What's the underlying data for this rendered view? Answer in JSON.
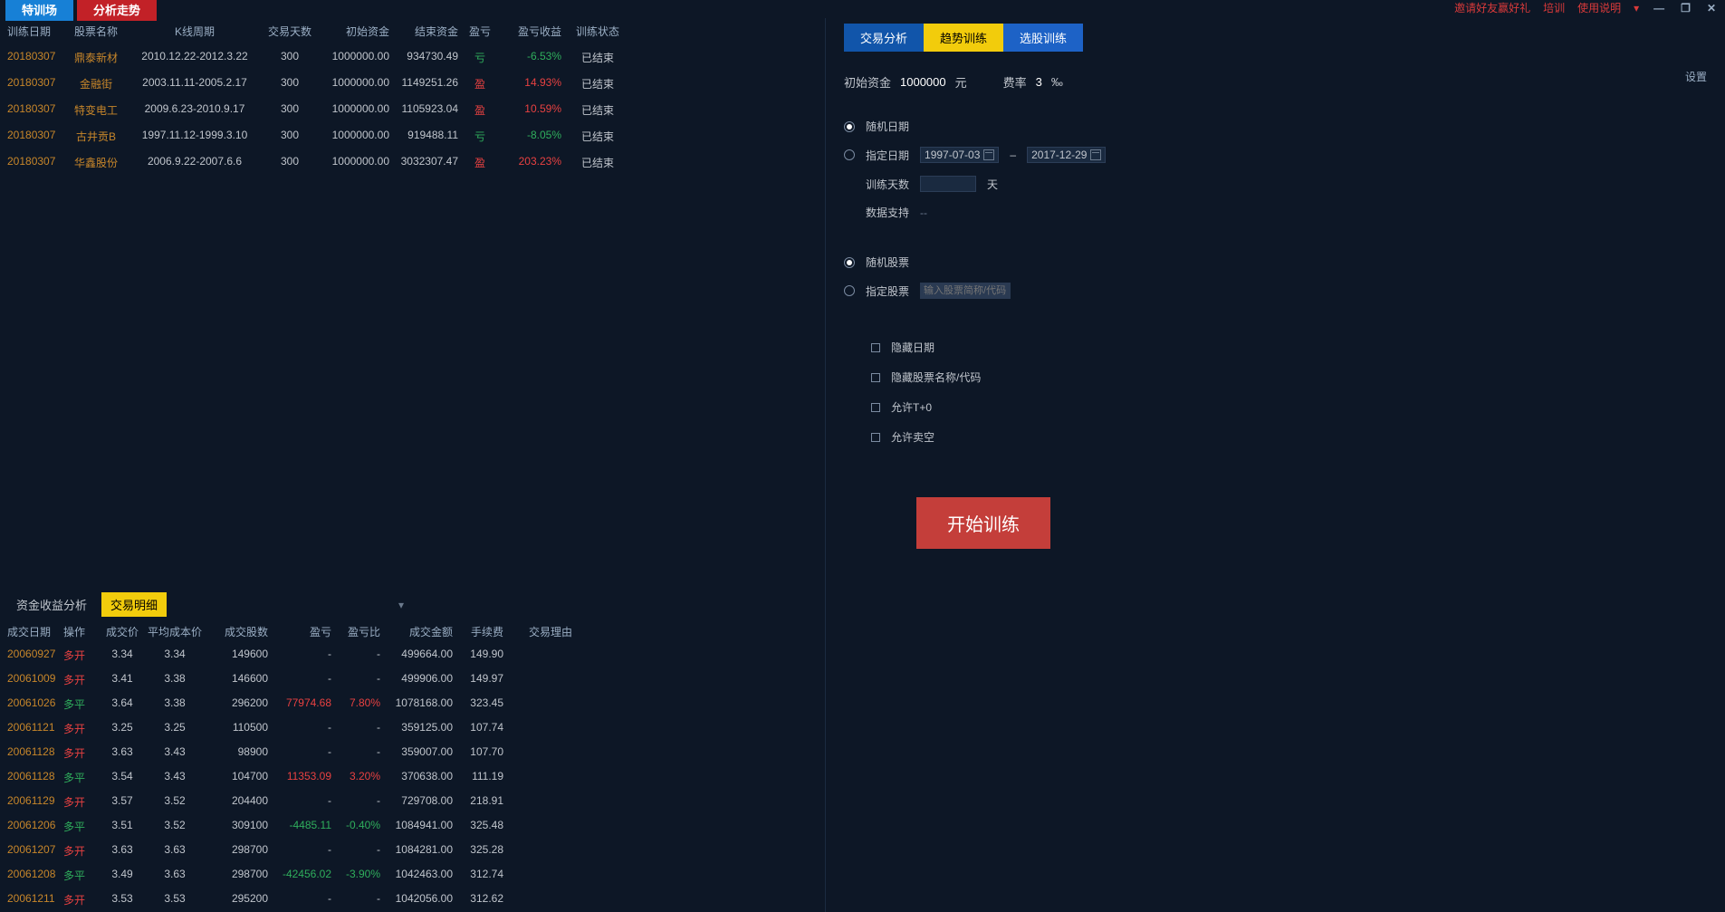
{
  "titlebar": {
    "tab_train": "特训场",
    "tab_trend": "分析走势",
    "invite": "邀请好友赢好礼",
    "train": "培训",
    "help": "使用说明"
  },
  "train_headers": [
    "训练日期",
    "股票名称",
    "K线周期",
    "交易天数",
    "初始资金",
    "结束资金",
    "盈亏",
    "盈亏收益",
    "训练状态"
  ],
  "train_rows": [
    {
      "date": "20180307",
      "name": "鼎泰新材",
      "period": "2010.12.22-2012.3.22",
      "days": "300",
      "init": "1000000.00",
      "end": "934730.49",
      "pl": "亏",
      "ret": "-6.53%",
      "ret_cls": "green",
      "status": "已结束"
    },
    {
      "date": "20180307",
      "name": "金融街",
      "period": "2003.11.11-2005.2.17",
      "days": "300",
      "init": "1000000.00",
      "end": "1149251.26",
      "pl": "盈",
      "ret": "14.93%",
      "ret_cls": "red",
      "status": "已结束"
    },
    {
      "date": "20180307",
      "name": "特变电工",
      "period": "2009.6.23-2010.9.17",
      "days": "300",
      "init": "1000000.00",
      "end": "1105923.04",
      "pl": "盈",
      "ret": "10.59%",
      "ret_cls": "red",
      "status": "已结束"
    },
    {
      "date": "20180307",
      "name": "古井贡B",
      "period": "1997.11.12-1999.3.10",
      "days": "300",
      "init": "1000000.00",
      "end": "919488.11",
      "pl": "亏",
      "ret": "-8.05%",
      "ret_cls": "green",
      "status": "已结束"
    },
    {
      "date": "20180307",
      "name": "华鑫股份",
      "period": "2006.9.22-2007.6.6",
      "days": "300",
      "init": "1000000.00",
      "end": "3032307.47",
      "pl": "盈",
      "ret": "203.23%",
      "ret_cls": "red",
      "status": "已结束"
    }
  ],
  "sub_tabs": {
    "fund": "资金收益分析",
    "detail": "交易明细"
  },
  "detail_headers": [
    "成交日期",
    "操作",
    "成交价",
    "平均成本价",
    "成交股数",
    "盈亏",
    "盈亏比",
    "成交金额",
    "手续费",
    "交易理由"
  ],
  "detail_rows": [
    {
      "date": "20060927",
      "op": "多开",
      "op_cls": "red",
      "price": "3.34",
      "avg": "3.34",
      "qty": "149600",
      "pl": "-",
      "plr": "-",
      "amt": "499664.00",
      "fee": "149.90"
    },
    {
      "date": "20061009",
      "op": "多开",
      "op_cls": "red",
      "price": "3.41",
      "avg": "3.38",
      "qty": "146600",
      "pl": "-",
      "plr": "-",
      "amt": "499906.00",
      "fee": "149.97"
    },
    {
      "date": "20061026",
      "op": "多平",
      "op_cls": "green",
      "price": "3.64",
      "avg": "3.38",
      "qty": "296200",
      "pl": "77974.68",
      "pl_cls": "red",
      "plr": "7.80%",
      "plr_cls": "red",
      "amt": "1078168.00",
      "fee": "323.45"
    },
    {
      "date": "20061121",
      "op": "多开",
      "op_cls": "red",
      "price": "3.25",
      "avg": "3.25",
      "qty": "110500",
      "pl": "-",
      "plr": "-",
      "amt": "359125.00",
      "fee": "107.74"
    },
    {
      "date": "20061128",
      "op": "多开",
      "op_cls": "red",
      "price": "3.63",
      "avg": "3.43",
      "qty": "98900",
      "pl": "-",
      "plr": "-",
      "amt": "359007.00",
      "fee": "107.70"
    },
    {
      "date": "20061128",
      "op": "多平",
      "op_cls": "green",
      "price": "3.54",
      "avg": "3.43",
      "qty": "104700",
      "pl": "11353.09",
      "pl_cls": "red",
      "plr": "3.20%",
      "plr_cls": "red",
      "amt": "370638.00",
      "fee": "111.19"
    },
    {
      "date": "20061129",
      "op": "多开",
      "op_cls": "red",
      "price": "3.57",
      "avg": "3.52",
      "qty": "204400",
      "pl": "-",
      "plr": "-",
      "amt": "729708.00",
      "fee": "218.91"
    },
    {
      "date": "20061206",
      "op": "多平",
      "op_cls": "green",
      "price": "3.51",
      "avg": "3.52",
      "qty": "309100",
      "pl": "-4485.11",
      "pl_cls": "green",
      "plr": "-0.40%",
      "plr_cls": "green",
      "amt": "1084941.00",
      "fee": "325.48"
    },
    {
      "date": "20061207",
      "op": "多开",
      "op_cls": "red",
      "price": "3.63",
      "avg": "3.63",
      "qty": "298700",
      "pl": "-",
      "plr": "-",
      "amt": "1084281.00",
      "fee": "325.28"
    },
    {
      "date": "20061208",
      "op": "多平",
      "op_cls": "green",
      "price": "3.49",
      "avg": "3.63",
      "qty": "298700",
      "pl": "-42456.02",
      "pl_cls": "green",
      "plr": "-3.90%",
      "plr_cls": "green",
      "amt": "1042463.00",
      "fee": "312.74"
    },
    {
      "date": "20061211",
      "op": "多开",
      "op_cls": "red",
      "price": "3.53",
      "avg": "3.53",
      "qty": "295200",
      "pl": "-",
      "plr": "-",
      "amt": "1042056.00",
      "fee": "312.62"
    }
  ],
  "right": {
    "tab_trade": "交易分析",
    "tab_trend": "趋势训练",
    "tab_stock": "选股训练",
    "init_fund_lbl": "初始资金",
    "init_fund_val": "1000000",
    "unit": "元",
    "rate_lbl": "费率",
    "rate_val": "3",
    "rate_unit": "‰",
    "settings": "设置",
    "rand_date": "随机日期",
    "spec_date": "指定日期",
    "date_from": "1997-07-03",
    "date_to": "2017-12-29",
    "train_days_lbl": "训练天数",
    "days_unit": "天",
    "data_support_lbl": "数据支持",
    "data_support_val": "--",
    "rand_stock": "随机股票",
    "spec_stock": "指定股票",
    "stock_ph": "输入股票简称/代码",
    "hide_date": "隐藏日期",
    "hide_name": "隐藏股票名称/代码",
    "allow_t0": "允许T+0",
    "allow_short": "允许卖空",
    "start": "开始训练"
  }
}
